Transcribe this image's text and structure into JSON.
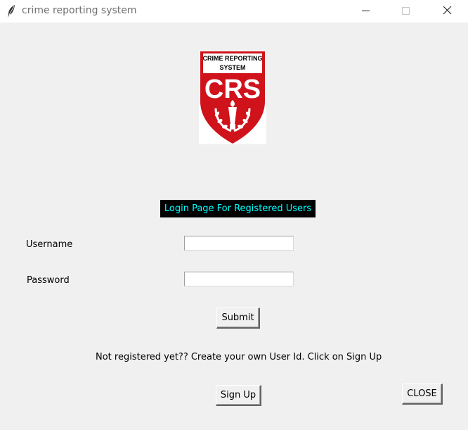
{
  "window": {
    "title": "crime reporting system",
    "icon": "feather-icon",
    "controls": [
      "minimize-icon",
      "maximize-icon",
      "close-icon"
    ]
  },
  "logo": {
    "line1": "CRIME REPORTING",
    "line2": "SYSTEM",
    "initials": "CRS",
    "icon": "torch-laurel-shield-icon",
    "colors": {
      "red": "#d0121b",
      "white": "#ffffff"
    }
  },
  "heading": {
    "text": "Login Page For Registered Users",
    "bg": "#000000",
    "fg": "#00ffff"
  },
  "form": {
    "username_label": "Username",
    "username_value": "",
    "password_label": "Password",
    "password_value": "",
    "submit_label": "Submit"
  },
  "info_text": "Not registered yet?? Create your own User Id. Click on Sign Up",
  "buttons": {
    "signup_label": "Sign Up",
    "close_label": "CLOSE"
  }
}
